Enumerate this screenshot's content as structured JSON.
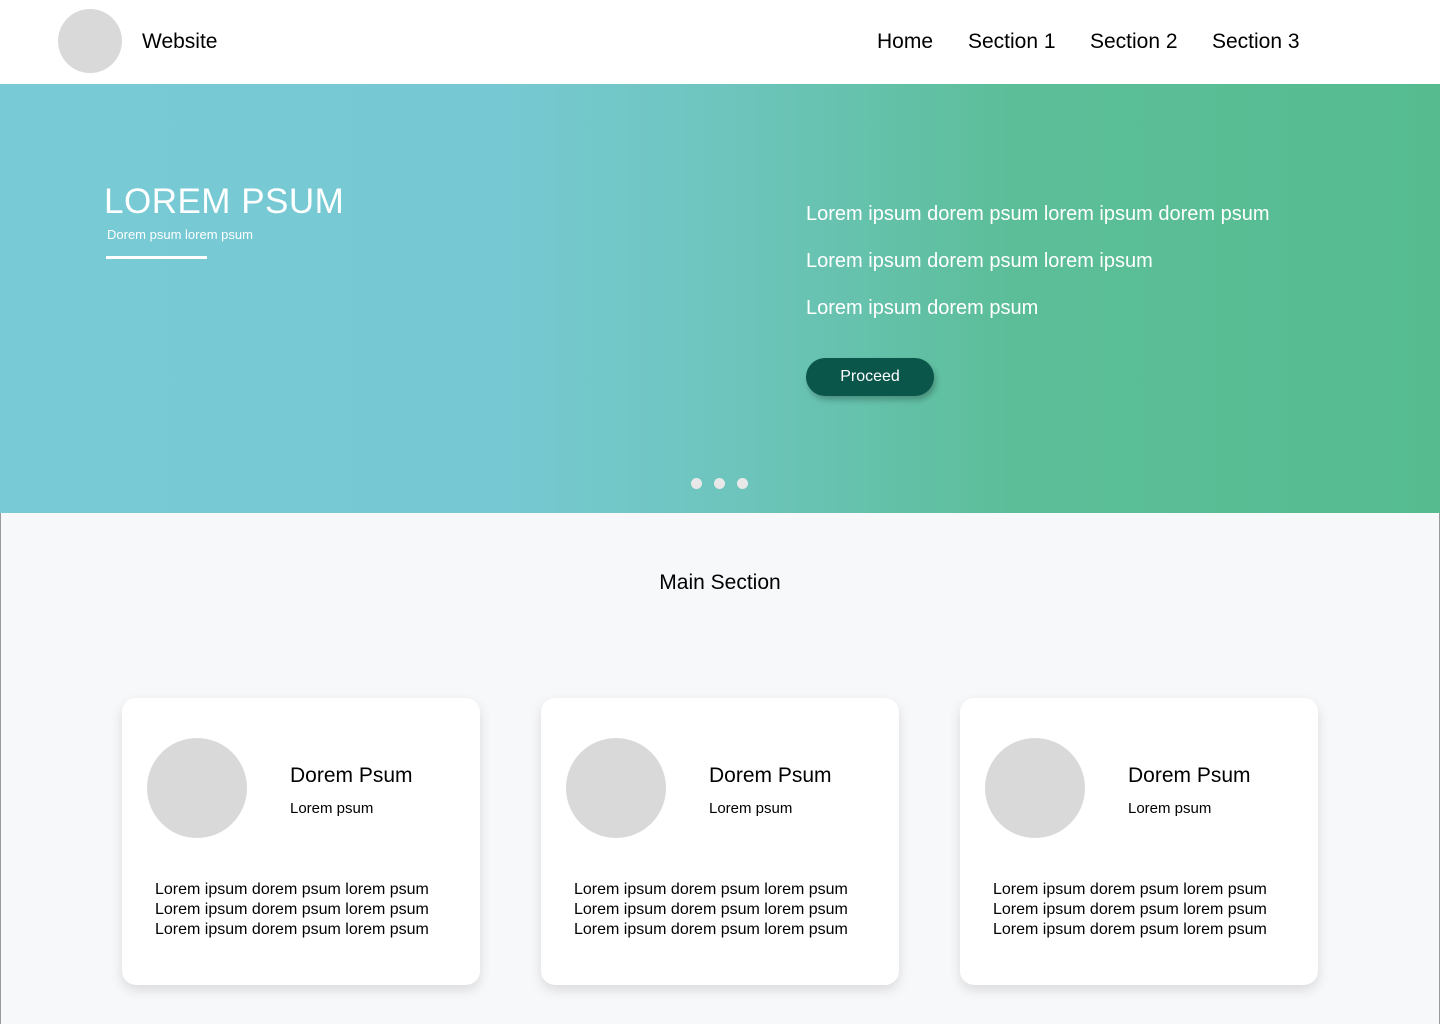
{
  "header": {
    "site_name": "Website",
    "nav": [
      "Home",
      "Section 1",
      "Section 2",
      "Section 3"
    ]
  },
  "hero": {
    "title": "LOREM PSUM",
    "subtitle": "Dorem psum lorem psum",
    "lines": [
      "Lorem ipsum dorem psum lorem ipsum dorem psum",
      "Lorem ipsum dorem psum lorem ipsum",
      "Lorem ipsum dorem psum"
    ],
    "button_label": "Proceed",
    "carousel_slides": 3
  },
  "main": {
    "title": "Main Section",
    "cards": [
      {
        "name": "Dorem Psum",
        "role": "Lorem psum",
        "lines": [
          "Lorem ipsum dorem psum lorem psum",
          "Lorem ipsum dorem psum lorem psum",
          "Lorem ipsum dorem psum lorem psum"
        ]
      },
      {
        "name": "Dorem Psum",
        "role": "Lorem psum",
        "lines": [
          "Lorem ipsum dorem psum lorem psum",
          "Lorem ipsum dorem psum lorem psum",
          "Lorem ipsum dorem psum lorem psum"
        ]
      },
      {
        "name": "Dorem Psum",
        "role": "Lorem psum",
        "lines": [
          "Lorem ipsum dorem psum lorem psum",
          "Lorem ipsum dorem psum lorem psum",
          "Lorem ipsum dorem psum lorem psum"
        ]
      }
    ]
  },
  "colors": {
    "hero_start": "#78cad6",
    "hero_end": "#56bc90",
    "button": "#0a564a",
    "placeholder": "#d9d9d9",
    "page_bg": "#f7f8fa"
  }
}
